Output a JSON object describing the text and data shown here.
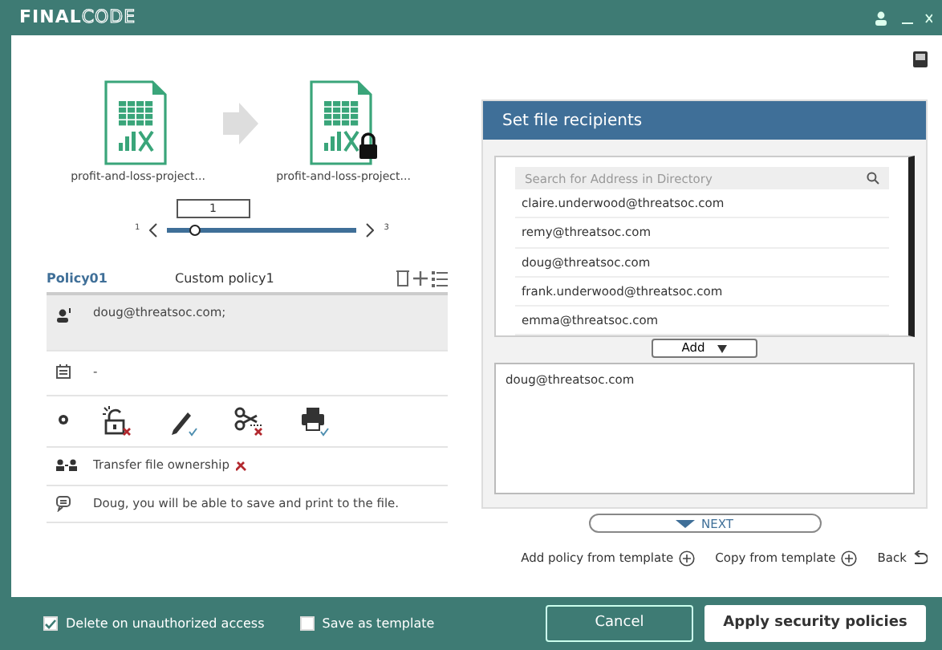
{
  "app": {
    "brand_bold": "FINAL",
    "brand_light": "CODE"
  },
  "files": [
    {
      "name": "profit-and-loss-project...",
      "locked": false
    },
    {
      "name": "profit-and-loss-project...",
      "locked": true
    }
  ],
  "slider": {
    "tooltip": "1",
    "min_label": "1",
    "max_label": "3",
    "level": 0.15
  },
  "policy": {
    "name": "Policy01",
    "title": "Custom policy1",
    "rows": [
      {
        "kind": "recipients",
        "text": "doug@threatsoc.com;",
        "selected": true
      },
      {
        "kind": "date",
        "text": "-",
        "selected": false
      },
      {
        "kind": "permissions",
        "selected": false,
        "permissions": [
          {
            "kind": "copy",
            "allowed": false
          },
          {
            "kind": "edit",
            "allowed": true
          },
          {
            "kind": "cut",
            "allowed": false
          },
          {
            "kind": "print",
            "allowed": true
          }
        ]
      },
      {
        "kind": "transfer",
        "text": "Transfer file ownership",
        "allowed": false,
        "selected": false
      },
      {
        "kind": "message",
        "text": "Doug, you will be able to save and print to the file.",
        "selected": false
      }
    ]
  },
  "recipients_panel": {
    "title": "Set file recipients",
    "search": {
      "placeholder": "Search for Address in Directory"
    },
    "directory": [
      "claire.underwood@threatsoc.com",
      "remy@threatsoc.com",
      "doug@threatsoc.com",
      "frank.underwood@threatsoc.com",
      "emma@threatsoc.com"
    ],
    "add_button": "Add",
    "selected_recipients": "doug@threatsoc.com",
    "next_button": "NEXT"
  },
  "links": [
    {
      "label": "Add policy from template",
      "kind": "add"
    },
    {
      "label": "Copy from template",
      "kind": "add"
    },
    {
      "label": "Back",
      "kind": "back"
    }
  ],
  "footer": {
    "options": [
      {
        "label": "Delete on unauthorized access",
        "checked": true
      },
      {
        "label": "Save as template",
        "checked": false
      }
    ],
    "buttons": [
      {
        "label": "Cancel",
        "kind": "secondary"
      },
      {
        "label": "Apply security policies",
        "kind": "primary"
      }
    ]
  }
}
